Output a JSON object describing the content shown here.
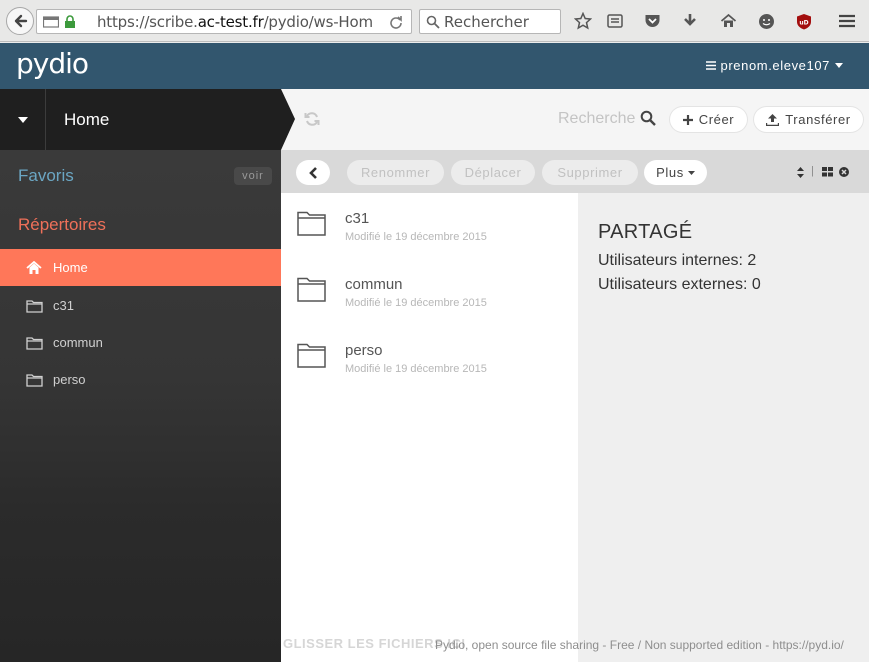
{
  "browser": {
    "url_prefix": "https://scribe.",
    "url_domain": "ac-test.fr",
    "url_suffix": "/pydio/ws-Hom",
    "search_placeholder": "Rechercher"
  },
  "header": {
    "logo": "pydio",
    "user": "prenom.eleve107"
  },
  "workspace": {
    "title": "Home"
  },
  "sidebar": {
    "favorites_title": "Favoris",
    "favorites_button": "voir",
    "repos_title": "Répertoires",
    "items": [
      {
        "label": "Home",
        "icon": "home-icon"
      },
      {
        "label": "c31",
        "icon": "folder-icon"
      },
      {
        "label": "commun",
        "icon": "folder-icon"
      },
      {
        "label": "perso",
        "icon": "folder-icon"
      }
    ]
  },
  "main_header": {
    "search_label": "Recherche",
    "create_label": "Créer",
    "upload_label": "Transférer"
  },
  "toolbar": {
    "rename": "Renommer",
    "move": "Déplacer",
    "delete": "Supprimer",
    "more": "Plus"
  },
  "files": [
    {
      "name": "c31",
      "modified": "Modifié le 19 décembre 2015"
    },
    {
      "name": "commun",
      "modified": "Modifié le 19 décembre 2015"
    },
    {
      "name": "perso",
      "modified": "Modifié le 19 décembre 2015"
    }
  ],
  "info": {
    "title": "PARTAGÉ",
    "internal": "Utilisateurs internes: 2",
    "external": "Utilisateurs externes: 0"
  },
  "footer": {
    "drop_hint": "GLISSER LES FICHIERS ICI",
    "text": "Pydio, open source file sharing - Free / Non supported edition - https://pyd.io/"
  },
  "colors": {
    "header": "#32566e",
    "accent": "#ff7759",
    "favorites": "#6ba6c3",
    "repos": "#ef7059"
  }
}
